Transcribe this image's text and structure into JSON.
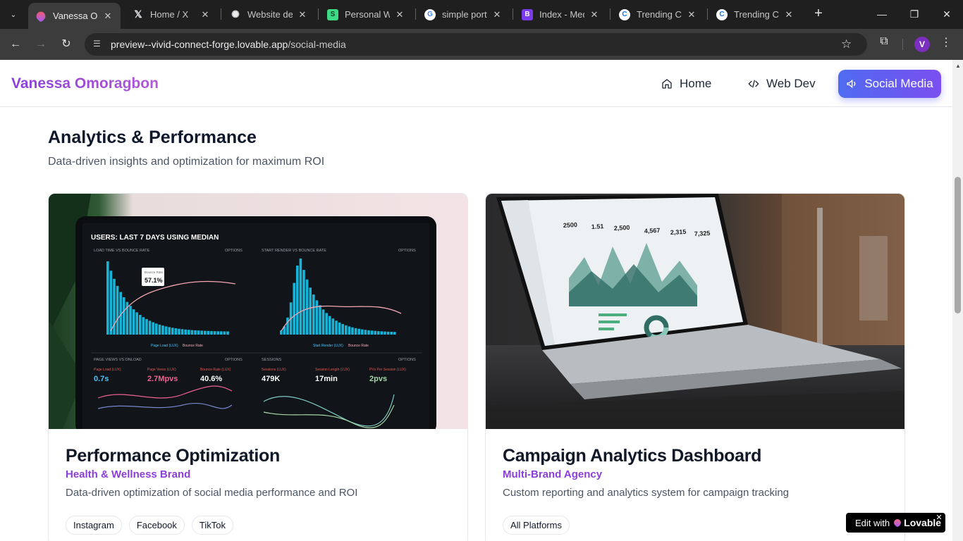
{
  "browser": {
    "tabs": [
      {
        "title": "Vanessa Om",
        "favicon": "lovable-heart-icon",
        "active": true
      },
      {
        "title": "Home / X",
        "favicon": "x-logo-icon"
      },
      {
        "title": "Website des",
        "favicon": "openai-icon"
      },
      {
        "title": "Personal We",
        "favicon": "green-s-icon"
      },
      {
        "title": "simple portfo",
        "favicon": "google-icon"
      },
      {
        "title": "Index - Medi",
        "favicon": "purple-b-icon"
      },
      {
        "title": "Trending Col",
        "favicon": "c-logo-icon"
      },
      {
        "title": "Trending Col",
        "favicon": "c-logo-icon"
      }
    ],
    "url_host": "preview--vivid-connect-forge.lovable.app",
    "url_path": "/social-media",
    "profile_initial": "V"
  },
  "site": {
    "brand": "Vanessa Omoragbon",
    "nav": {
      "home": "Home",
      "webdev": "Web Dev",
      "social": "Social Media"
    }
  },
  "section": {
    "title": "Analytics & Performance",
    "subtitle": "Data-driven insights and optimization for maximum ROI"
  },
  "cards": [
    {
      "title": "Performance Optimization",
      "client": "Health & Wellness Brand",
      "description": "Data-driven optimization of social media performance and ROI",
      "tags": [
        "Instagram",
        "Facebook",
        "TikTok"
      ],
      "image": {
        "header": "USERS: LAST 7 DAYS USING MEDIAN",
        "panel1": "LOAD TIME VS BOUNCE RATE",
        "panel2": "START RENDER VS BOUNCE RATE",
        "options": "OPTIONS",
        "callout": "57.1%",
        "callout_label": "Bounce Rate",
        "legend1a": "Page Load (LUX)",
        "legend1b": "Bounce Rate",
        "legend2a": "Start Render (LUX)",
        "legend2b": "Bounce Rate",
        "panel3": "PAGE VIEWS VS ONLOAD",
        "panel4": "SESSIONS",
        "metrics": [
          {
            "label": "Page Load (LUX)",
            "value": "0.7s",
            "color": "#4fc3f7"
          },
          {
            "label": "Page Views (LUX)",
            "value": "2.7Mpvs",
            "color": "#f06292"
          },
          {
            "label": "Bounce Rate (LUX)",
            "value": "40.6%",
            "color": "#ffffff"
          },
          {
            "label": "Sessions (LUX)",
            "value": "479K",
            "color": "#ffffff"
          },
          {
            "label": "Session Length (LUX)",
            "value": "17min",
            "color": "#ffffff"
          },
          {
            "label": "PVs Per Session (LUX)",
            "value": "2pvs",
            "color": "#a5d6a7"
          }
        ]
      }
    },
    {
      "title": "Campaign Analytics Dashboard",
      "client": "Multi-Brand Agency",
      "description": "Custom reporting and analytics system for campaign tracking",
      "tags": [
        "All Platforms"
      ],
      "image": {
        "kpis": [
          "2500",
          "1.51",
          "2,500",
          "4,567",
          "2,315",
          "7,325"
        ]
      }
    }
  ],
  "badge": {
    "prefix": "Edit with",
    "brand": "Lovable"
  }
}
